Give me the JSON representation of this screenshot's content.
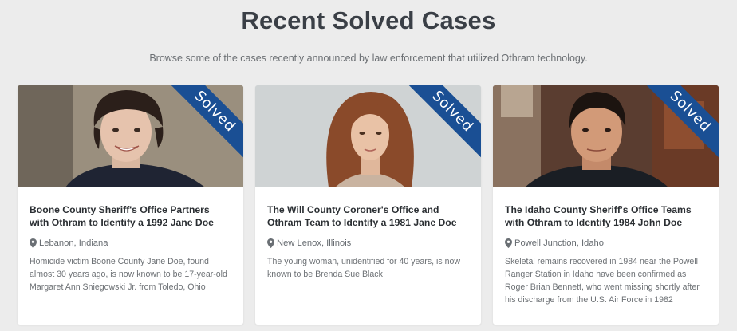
{
  "header": {
    "title": "Recent Solved Cases",
    "subtitle": "Browse some of the cases recently announced by law enforcement that utilized Othram technology."
  },
  "colors": {
    "ribbon": "#1a4f94",
    "background": "#ececec"
  },
  "cases": [
    {
      "badge": "Solved",
      "title": "Boone County Sheriff's Office Partners with Othram to Identify a 1992 Jane Doe",
      "location": "Lebanon, Indiana",
      "location_icon": "map-pin-icon",
      "description": "Homicide victim Boone County Jane Doe, found almost 30 years ago, is now known to be 17-year-old Margaret Ann Sniegowski Jr. from Toledo, Ohio"
    },
    {
      "badge": "Solved",
      "title": "The Will County Coroner's Office and Othram Team to Identify a 1981 Jane Doe",
      "location": "New Lenox, Illinois",
      "location_icon": "map-pin-icon",
      "description": "The young woman, unidentified for 40 years, is now known to be Brenda Sue Black"
    },
    {
      "badge": "Solved",
      "title": "The Idaho County Sheriff's Office Teams with Othram to Identify 1984 John Doe",
      "location": "Powell Junction, Idaho",
      "location_icon": "map-pin-icon",
      "description": "Skeletal remains recovered in 1984 near the Powell Ranger Station in Idaho have been confirmed as Roger Brian Bennett, who went missing shortly after his discharge from the U.S. Air Force in 1982"
    }
  ]
}
